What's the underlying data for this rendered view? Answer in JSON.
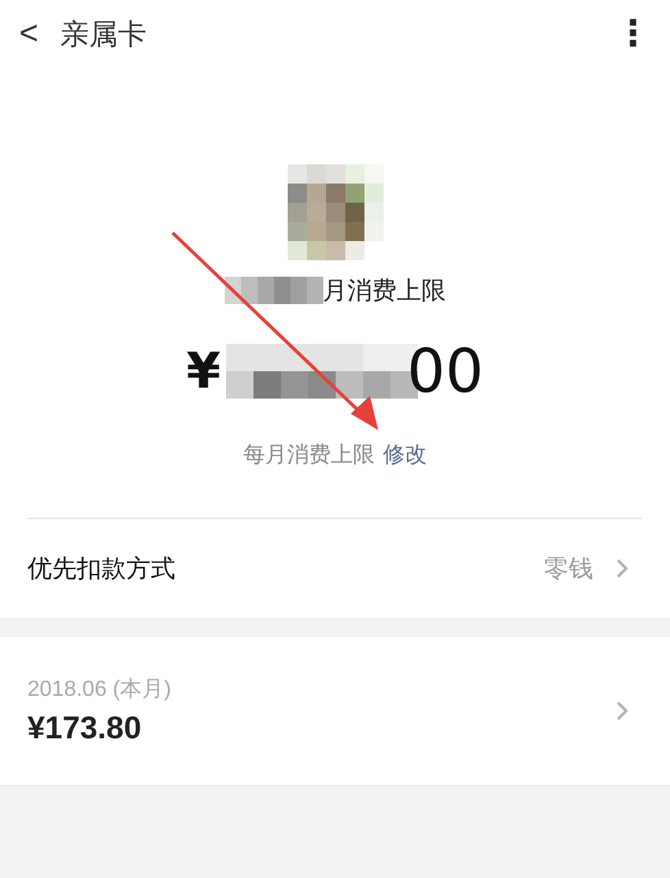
{
  "header": {
    "back": "<",
    "title": "亲属卡",
    "more": "⋮"
  },
  "member": {
    "name_visible": "月消费上限",
    "currency": "¥",
    "amount_visible": "00",
    "caption": "每月消费上限",
    "edit_link": "修改"
  },
  "payment": {
    "label": "优先扣款方式",
    "value": "零钱"
  },
  "bill": {
    "period": "2018.06 (本月)",
    "total": "¥173.80"
  }
}
